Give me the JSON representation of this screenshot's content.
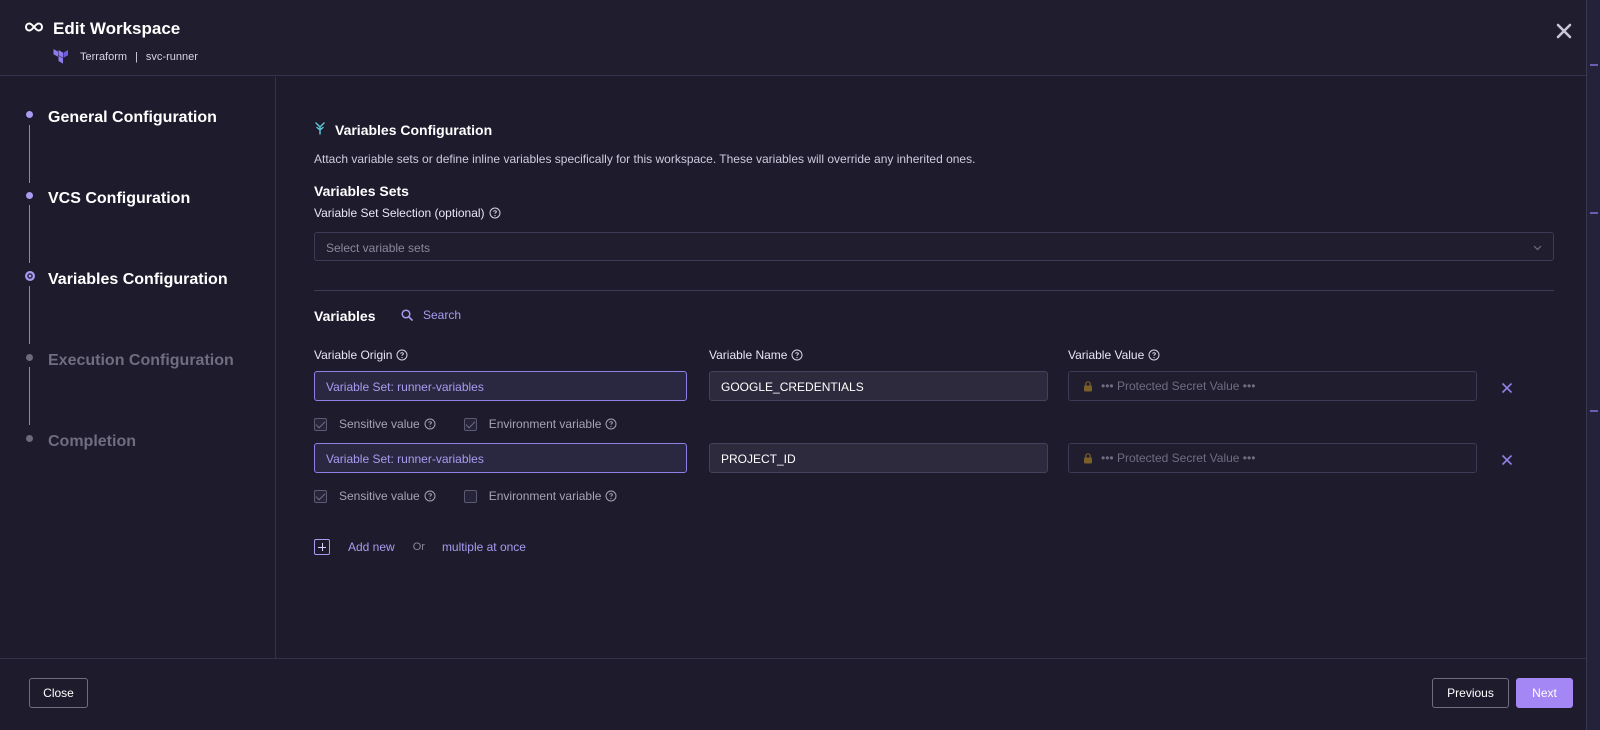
{
  "header": {
    "title": "Edit Workspace",
    "provider": "Terraform",
    "separator": "|",
    "workspace": "svc-runner"
  },
  "sidebar": {
    "steps": [
      {
        "label": "General Configuration",
        "state": "done"
      },
      {
        "label": "VCS Configuration",
        "state": "done"
      },
      {
        "label": "Variables Configuration",
        "state": "current"
      },
      {
        "label": "Execution Configuration",
        "state": "pending"
      },
      {
        "label": "Completion",
        "state": "pending"
      }
    ]
  },
  "main": {
    "section_title": "Variables Configuration",
    "section_description": "Attach variable sets or define inline variables specifically for this workspace. These variables will override any inherited ones.",
    "sets_title": "Variables Sets",
    "set_selection_label": "Variable Set Selection (optional)",
    "set_selection_placeholder": "Select variable sets",
    "variables_title": "Variables",
    "search_label": "Search",
    "columns": {
      "origin": "Variable Origin",
      "name": "Variable Name",
      "value": "Variable Value"
    },
    "rows": [
      {
        "origin": "Variable Set: runner-variables",
        "name": "GOOGLE_CREDENTIALS",
        "value": "••• Protected Secret Value •••",
        "sensitive_label": "Sensitive value",
        "sensitive": true,
        "env_label": "Environment variable",
        "env": true
      },
      {
        "origin": "Variable Set: runner-variables",
        "name": "PROJECT_ID",
        "value": "••• Protected Secret Value •••",
        "sensitive_label": "Sensitive value",
        "sensitive": true,
        "env_label": "Environment variable",
        "env": false
      }
    ],
    "add_new_label": "Add new",
    "or_label": "Or",
    "multiple_label": "multiple at once"
  },
  "footer": {
    "close_label": "Close",
    "previous_label": "Previous",
    "next_label": "Next"
  },
  "colors": {
    "accent": "#a89cf0",
    "primary_button": "#a486f5",
    "background": "#1d1b2c"
  }
}
